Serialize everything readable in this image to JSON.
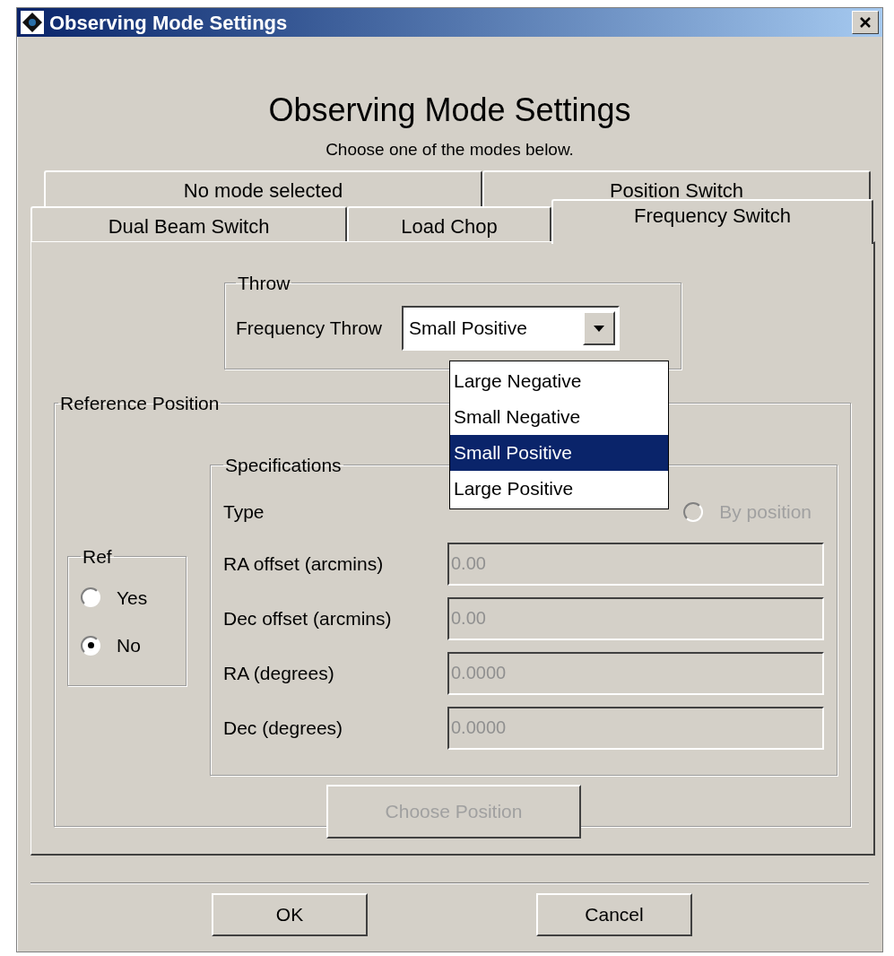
{
  "window": {
    "title": "Observing Mode Settings"
  },
  "heading": "Observing Mode Settings",
  "subtitle": "Choose one of the modes below.",
  "tab_rows": [
    {
      "tabs": [
        {
          "label": "No mode selected",
          "selected": false
        },
        {
          "label": "Position Switch",
          "selected": false
        }
      ]
    },
    {
      "tabs": [
        {
          "label": "Dual Beam Switch",
          "selected": false
        },
        {
          "label": "Load Chop",
          "selected": false
        },
        {
          "label": "Frequency Switch",
          "selected": true
        }
      ]
    }
  ],
  "throw": {
    "title": "Throw",
    "label": "Frequency Throw",
    "value": "Small Positive",
    "expanded": true,
    "options": [
      {
        "label": "Large Negative",
        "selected": false
      },
      {
        "label": "Small Negative",
        "selected": false
      },
      {
        "label": "Small Positive",
        "selected": true
      },
      {
        "label": "Large Positive",
        "selected": false
      }
    ]
  },
  "reference": {
    "title": "Reference Position",
    "ref": {
      "title": "Ref",
      "options": [
        {
          "label": "Yes",
          "selected": false
        },
        {
          "label": "No",
          "selected": true
        }
      ]
    },
    "specifications": {
      "title": "Specifications",
      "type_label": "Type",
      "type_options": [
        {
          "label": "By position",
          "selected": false,
          "disabled": true
        }
      ],
      "fields": [
        {
          "label": "RA offset (arcmins)",
          "value": "0.00",
          "disabled": true
        },
        {
          "label": "Dec offset (arcmins)",
          "value": "0.00",
          "disabled": true
        },
        {
          "label": "RA (degrees)",
          "value": "0.0000",
          "disabled": true
        },
        {
          "label": "Dec (degrees)",
          "value": "0.0000",
          "disabled": true
        }
      ]
    },
    "choose_button": {
      "label": "Choose Position",
      "disabled": true
    }
  },
  "buttons": [
    "OK",
    "Cancel"
  ]
}
